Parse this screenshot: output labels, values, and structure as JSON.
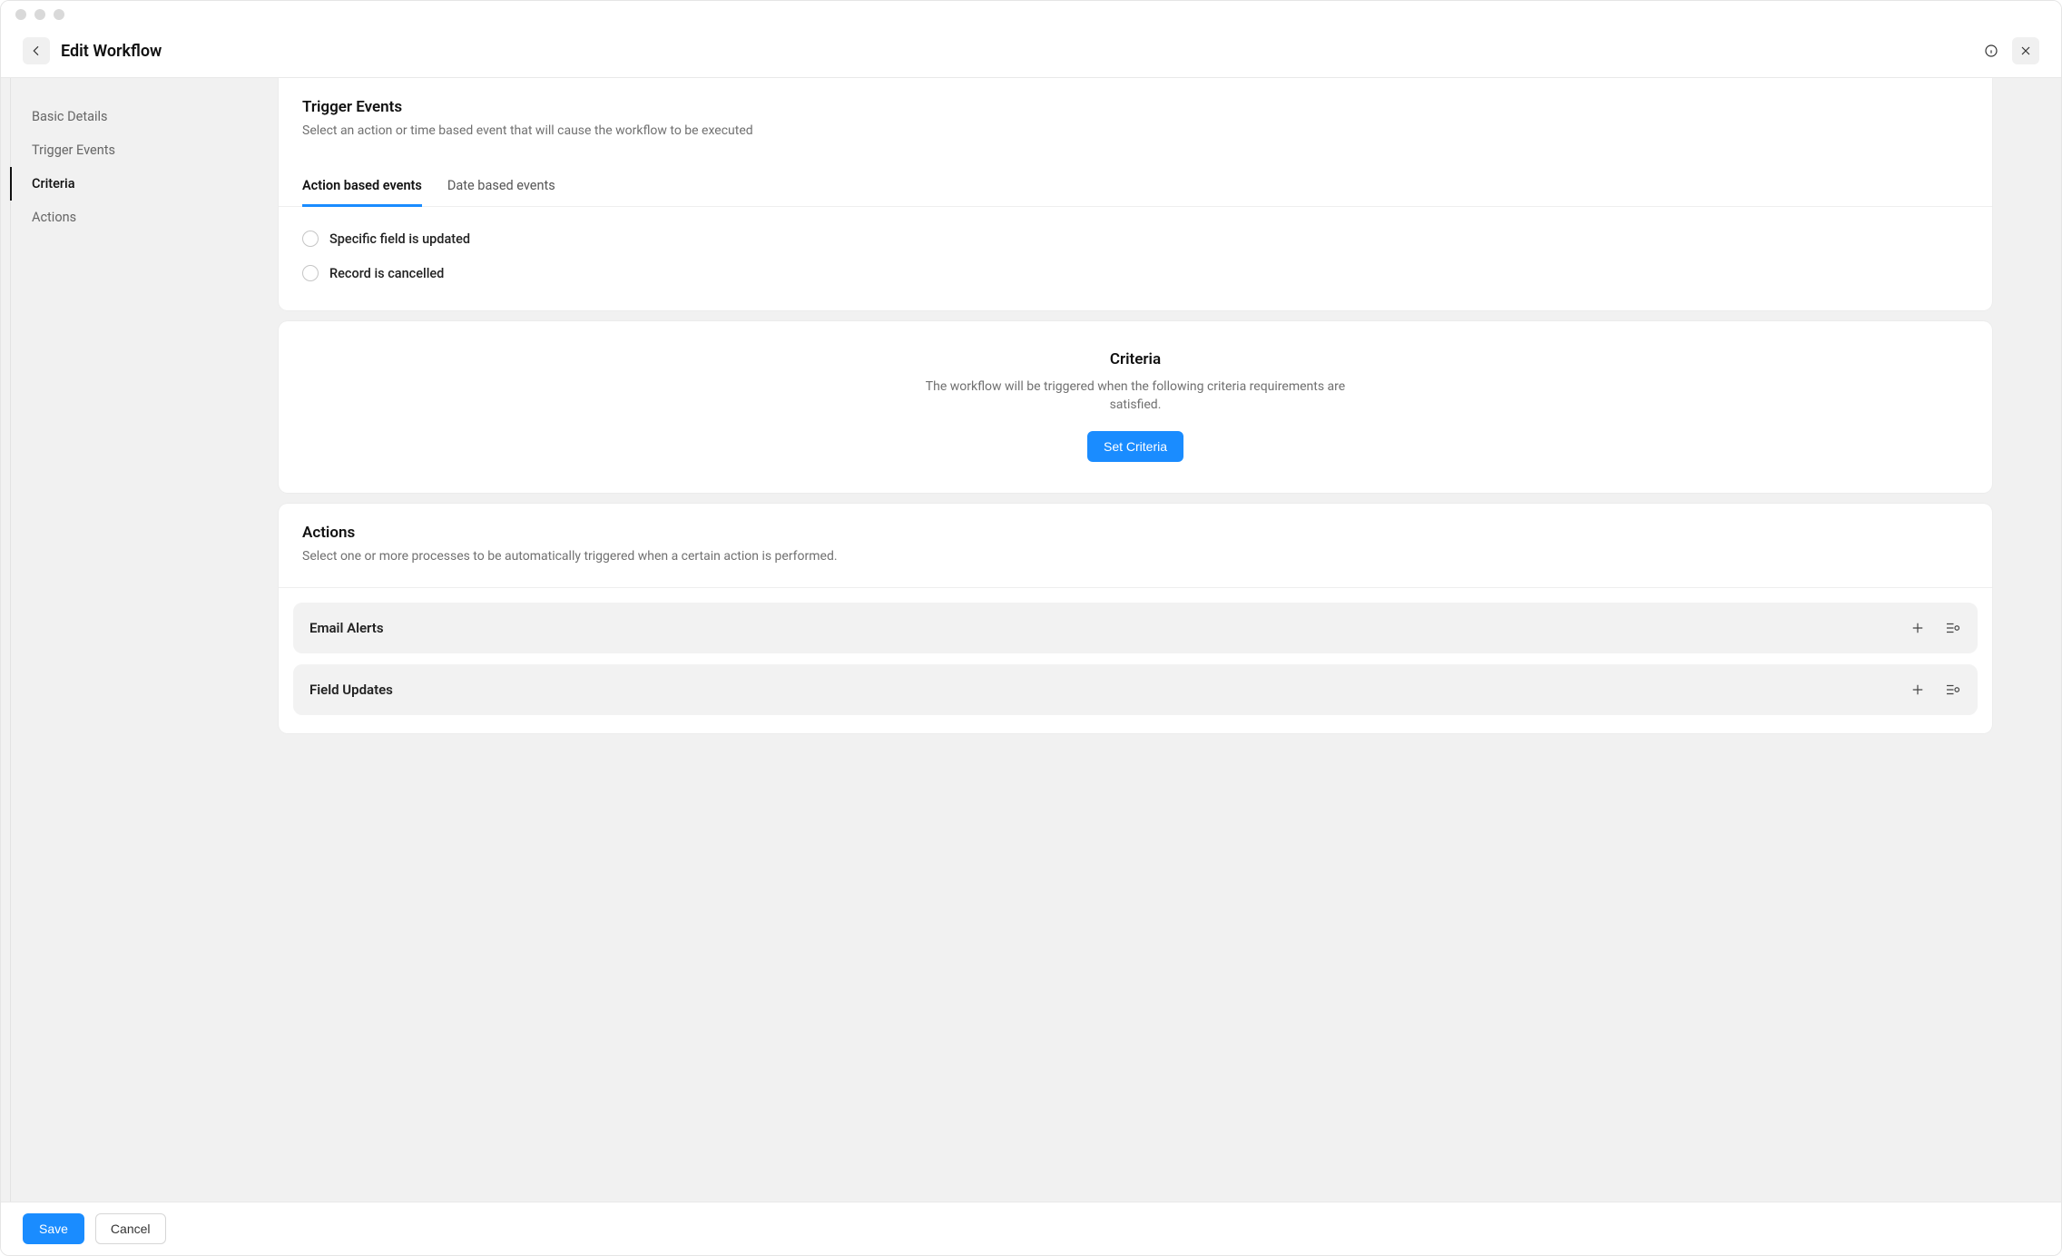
{
  "header": {
    "title": "Edit Workflow"
  },
  "sidebar": {
    "items": [
      {
        "label": "Basic Details",
        "active": false
      },
      {
        "label": "Trigger Events",
        "active": false
      },
      {
        "label": "Criteria",
        "active": true
      },
      {
        "label": "Actions",
        "active": false
      }
    ]
  },
  "trigger": {
    "title": "Trigger Events",
    "description": "Select an action or time based event that will cause the workflow to be executed",
    "tabs": [
      {
        "label": "Action based events",
        "active": true
      },
      {
        "label": "Date based events",
        "active": false
      }
    ],
    "options": [
      {
        "label": "Specific field is updated",
        "selected": false
      },
      {
        "label": "Record is cancelled",
        "selected": false
      }
    ]
  },
  "criteria": {
    "title": "Criteria",
    "description": "The workflow will be triggered when the following criteria requirements are satisfied.",
    "button": "Set Criteria"
  },
  "actions": {
    "title": "Actions",
    "description": "Select one or more processes to be automatically triggered when a certain action is performed.",
    "blocks": [
      {
        "label": "Email Alerts"
      },
      {
        "label": "Field Updates"
      }
    ]
  },
  "footer": {
    "save": "Save",
    "cancel": "Cancel"
  }
}
